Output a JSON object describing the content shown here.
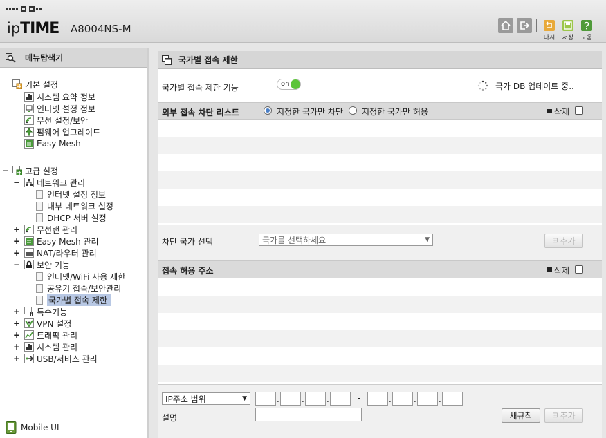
{
  "header": {
    "brand_ip": "ip",
    "brand_time": "TIME",
    "model": "A8004NS-M",
    "buttons": [
      {
        "icon": "home-icon",
        "label": ""
      },
      {
        "icon": "logout-icon",
        "label": ""
      },
      {
        "icon": "restart-icon",
        "label": "다시"
      },
      {
        "icon": "save-icon",
        "label": "저장"
      },
      {
        "icon": "help-icon",
        "label": "도움"
      }
    ],
    "colors": {
      "restart": "#e8a93a",
      "save": "#9cc64a",
      "help": "#4f9a3a"
    }
  },
  "sidebar": {
    "title": "메뉴탐색기",
    "basic": {
      "label": "기본 설정",
      "items": [
        "시스템 요약 정보",
        "인터넷 설정 정보",
        "무선 설정/보안",
        "펌웨어 업그레이드",
        "Easy Mesh"
      ]
    },
    "advanced": {
      "toggle": "−",
      "label": "고급 설정",
      "network": {
        "toggle": "−",
        "label": "네트워크 관리",
        "items": [
          "인터넷 설정 정보",
          "내부 네트워크 설정",
          "DHCP 서버 설정"
        ]
      },
      "groups_a": [
        {
          "toggle": "+",
          "label": "무선랜 관리"
        },
        {
          "toggle": "+",
          "label": "Easy Mesh 관리"
        },
        {
          "toggle": "+",
          "label": "NAT/라우터 관리"
        }
      ],
      "security": {
        "toggle": "−",
        "label": "보안 기능",
        "items": [
          "인터넷/WiFi 사용 제한",
          "공유기 접속/보안관리",
          "국가별 접속 제한"
        ]
      },
      "groups_b": [
        {
          "toggle": "+",
          "label": "특수기능"
        },
        {
          "toggle": "+",
          "label": "VPN 설정"
        },
        {
          "toggle": "+",
          "label": "트래픽 관리"
        },
        {
          "toggle": "+",
          "label": "시스템 관리"
        },
        {
          "toggle": "+",
          "label": "USB/서비스 관리"
        }
      ]
    },
    "mobile_ui": "Mobile UI"
  },
  "main": {
    "title": "국가별 접속 제한",
    "feature_label": "국가별 접속 제한 기능",
    "toggle_text": "on",
    "toggle_color": "#5cc43a",
    "db_status": "국가 DB 업데이트 중..",
    "block_list": {
      "title": "외부 접속 차단 리스트",
      "radio_block": "지정한 국가만 차단",
      "radio_allow": "지정한 국가만 허용",
      "selected": "block",
      "delete_label": "삭제"
    },
    "country_select": {
      "label": "차단 국가 선택",
      "placeholder": "국가를 선택하세요",
      "add_label": "추가"
    },
    "allow_address": {
      "title": "접속 허용 주소",
      "delete_label": "삭제"
    },
    "ip_form": {
      "type_value": "IP주소 범위",
      "dash": "-",
      "desc_label": "설명",
      "rule_button": "새규칙",
      "add_label": "추가"
    }
  }
}
